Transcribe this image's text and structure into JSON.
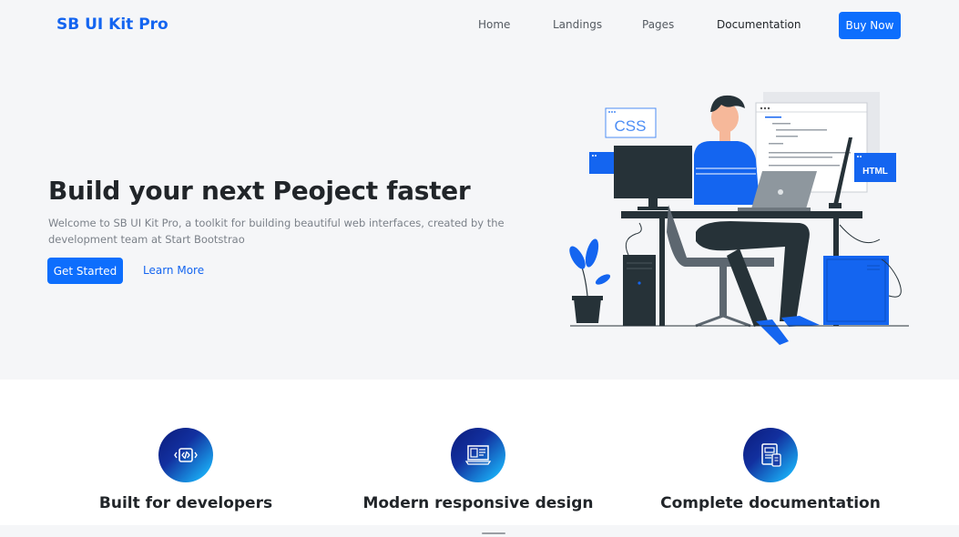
{
  "navbar": {
    "brand": "SB UI Kit Pro",
    "links": [
      "Home",
      "Landings",
      "Pages",
      "Documentation"
    ],
    "cta": "Buy Now"
  },
  "hero": {
    "title": "Build your next Peoject faster",
    "text": "Welcome to SB UI Kit Pro, a toolkit for building beautiful web interfaces, created by the development team at Start Bootstrao",
    "primary_button": "Get Started",
    "secondary_link": "Learn More",
    "illustration": {
      "css_label": "CSS",
      "html_label": "HTML"
    }
  },
  "features": [
    {
      "title": "Built for developers",
      "icon": "code-icon"
    },
    {
      "title": "Modern responsive design",
      "icon": "responsive-design-icon"
    },
    {
      "title": "Complete documentation",
      "icon": "documentation-icon"
    }
  ],
  "colors": {
    "brand": "#1465f0",
    "primary": "#0d6efd",
    "hero_background": "#f5f6f8",
    "icon_gradient_start": "#0b1b7a",
    "icon_gradient_end": "#22c4ff"
  }
}
